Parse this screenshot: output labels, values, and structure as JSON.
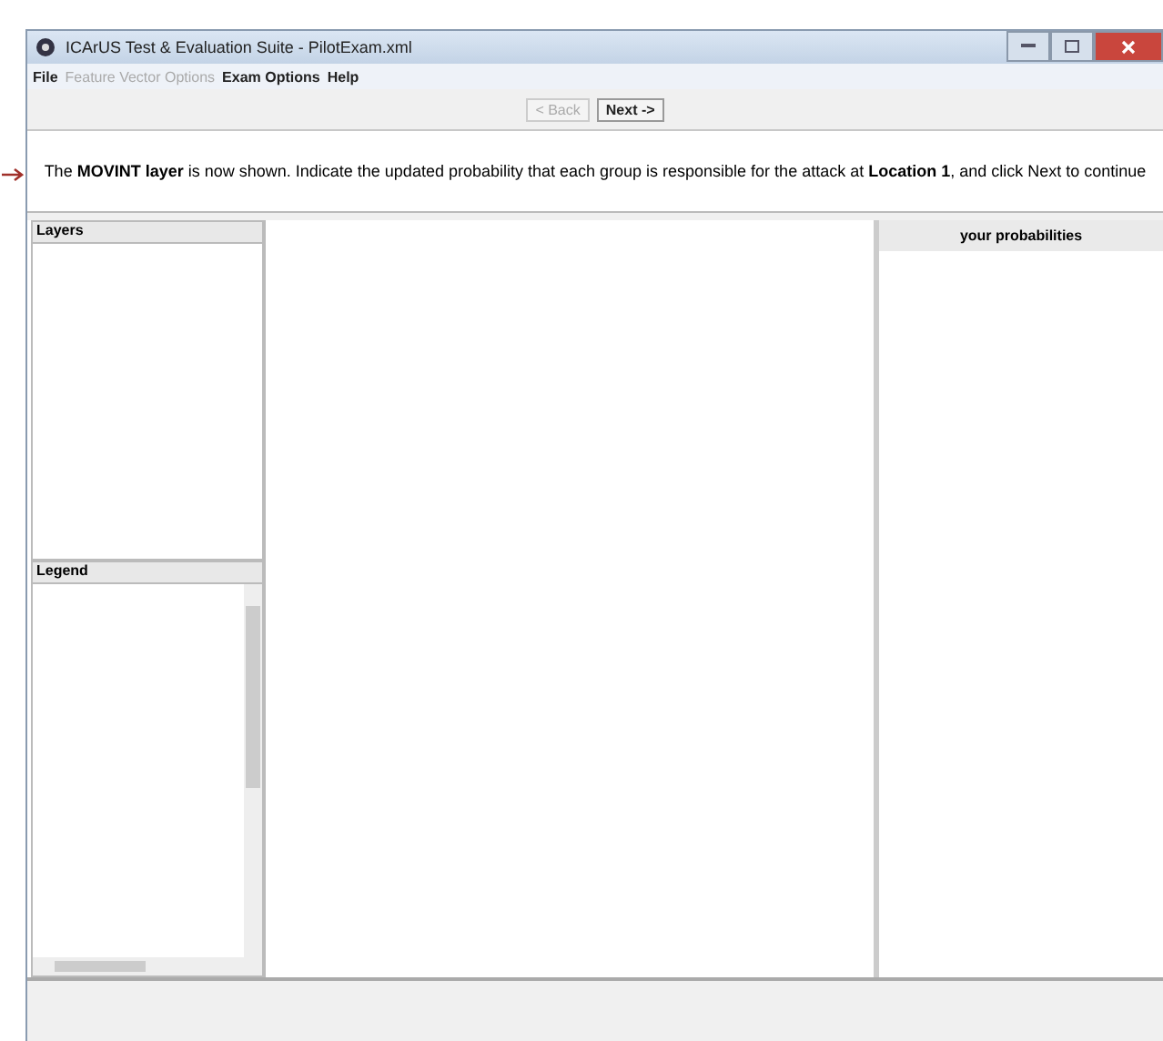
{
  "window": {
    "title": "ICArUS Test & Evaluation Suite - PilotExam.xml"
  },
  "menu": [
    {
      "label": "File",
      "disabled": false
    },
    {
      "label": "Feature Vector Options",
      "disabled": true
    },
    {
      "label": "Exam Options",
      "disabled": false
    },
    {
      "label": "Help",
      "disabled": false
    }
  ],
  "nav_buttons": [
    {
      "label": "< Back",
      "disabled": true
    },
    {
      "label": "Next ->",
      "disabled": false
    }
  ],
  "instruction": "The **MOVINT layer** is now shown. Indicate the updated probability that each group is responsible for the attack at **Location 1**, and click Next to continue",
  "layers_panel": {
    "title": "Layers"
  },
  "legend_panel": {
    "title": "Legend"
  },
  "probabilities_panel": {
    "title": "your probabilities"
  }
}
